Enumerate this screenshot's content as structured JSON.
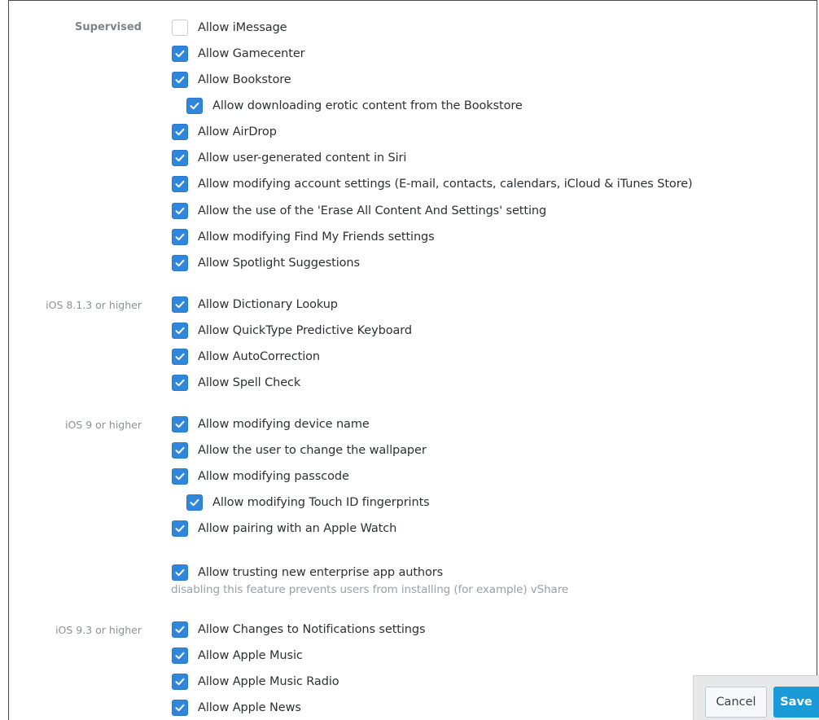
{
  "sections": {
    "supervised": "Supervised",
    "ios813": "iOS 8.1.3 or higher",
    "ios9": "iOS 9 or higher",
    "ios93": "iOS 9.3 or higher"
  },
  "options": {
    "imessage": {
      "label": "Allow iMessage",
      "checked": false
    },
    "gamecenter": {
      "label": "Allow Gamecenter",
      "checked": true
    },
    "bookstore": {
      "label": "Allow Bookstore",
      "checked": true
    },
    "bookstore_erotic": {
      "label": "Allow downloading erotic content from the Bookstore",
      "checked": true
    },
    "airdrop": {
      "label": "Allow AirDrop",
      "checked": true
    },
    "siri_ugc": {
      "label": "Allow user-generated content in Siri",
      "checked": true
    },
    "account_settings": {
      "label": "Allow modifying account settings (E-mail, contacts, calendars, iCloud & iTunes Store)",
      "checked": true
    },
    "erase_all": {
      "label": "Allow the use of the 'Erase All Content And Settings' setting",
      "checked": true
    },
    "find_friends": {
      "label": "Allow modifying Find My Friends settings",
      "checked": true
    },
    "spotlight": {
      "label": "Allow Spotlight Suggestions",
      "checked": true
    },
    "dictionary": {
      "label": "Allow Dictionary Lookup",
      "checked": true
    },
    "quicktype": {
      "label": "Allow QuickType Predictive Keyboard",
      "checked": true
    },
    "autocorrection": {
      "label": "Allow AutoCorrection",
      "checked": true
    },
    "spellcheck": {
      "label": "Allow Spell Check",
      "checked": true
    },
    "device_name": {
      "label": "Allow modifying device name",
      "checked": true
    },
    "wallpaper": {
      "label": "Allow the user to change the wallpaper",
      "checked": true
    },
    "passcode": {
      "label": "Allow modifying passcode",
      "checked": true
    },
    "touch_id": {
      "label": "Allow modifying Touch ID fingerprints",
      "checked": true
    },
    "apple_watch": {
      "label": "Allow pairing with an Apple Watch",
      "checked": true
    },
    "enterprise_trust": {
      "label": "Allow trusting new enterprise app authors",
      "checked": true
    },
    "notifications": {
      "label": "Allow Changes to Notifications settings",
      "checked": true
    },
    "apple_music": {
      "label": "Allow Apple Music",
      "checked": true
    },
    "apple_music_radio": {
      "label": "Allow Apple Music Radio",
      "checked": true
    },
    "apple_news": {
      "label": "Allow Apple News",
      "checked": true
    }
  },
  "hints": {
    "enterprise_trust": "disabling this feature prevents users from installing (for example) vShare"
  },
  "footer": {
    "cancel_label": "Cancel",
    "save_label": "Save"
  },
  "colors": {
    "checkbox_checked": "#2f86db",
    "save_button": "#1a9bd7"
  }
}
